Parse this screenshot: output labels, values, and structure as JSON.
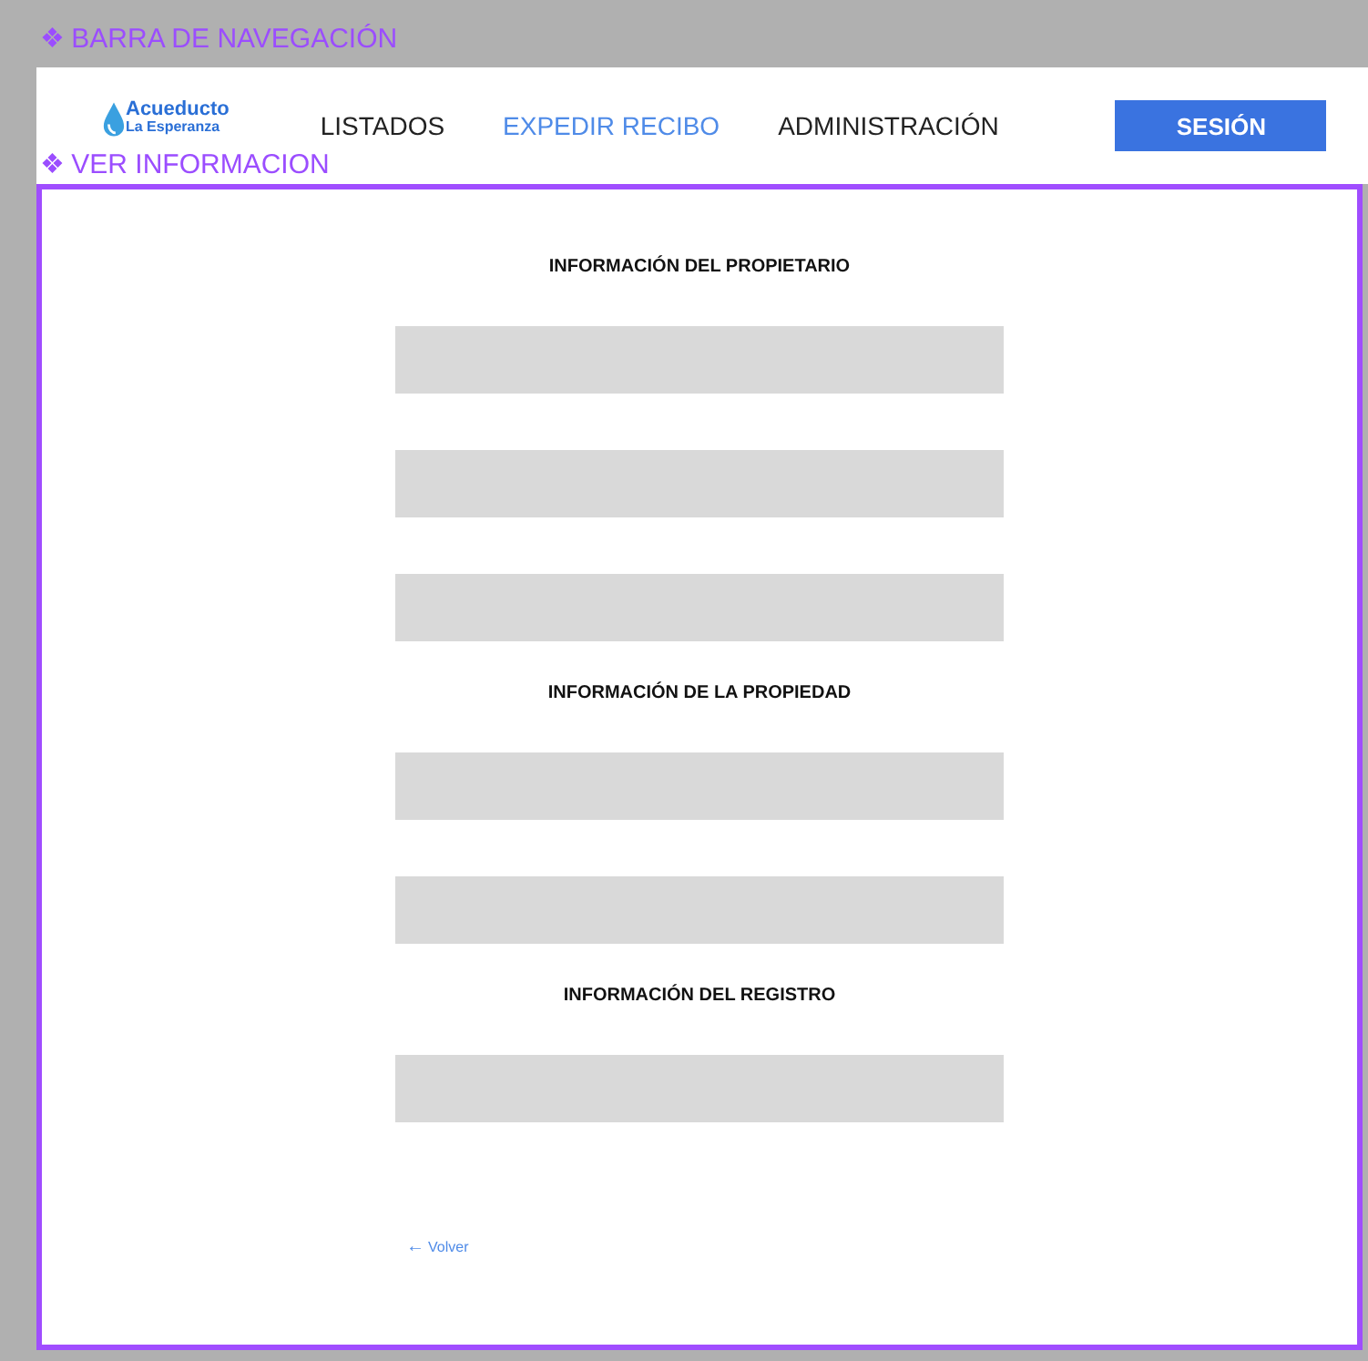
{
  "frame_labels": [
    "❖ BARRA DE NAVEGACIÓN",
    "❖ VER INFORMACION"
  ],
  "navbar": {
    "logo": {
      "title": "Acueducto",
      "subtitle": "La Esperanza"
    },
    "items": [
      {
        "label": "LISTADOS",
        "selected": false
      },
      {
        "label": "EXPEDIR RECIBO",
        "selected": true
      },
      {
        "label": "ADMINISTRACIÓN",
        "selected": false
      }
    ],
    "button": "SESIÓN"
  },
  "sections": [
    {
      "title": "INFORMACIÓN DEL PROPIETARIO",
      "fields": [
        {
          "kind": "input"
        },
        {
          "kind": "input"
        },
        {
          "kind": "input"
        }
      ]
    },
    {
      "title": "INFORMACIÓN DE LA PROPIEDAD",
      "fields": [
        {
          "kind": "input"
        },
        {
          "kind": "input"
        }
      ]
    },
    {
      "title": "INFORMACIÓN DEL REGISTRO",
      "fields": [
        {
          "kind": "input"
        }
      ]
    }
  ],
  "back_link": {
    "icon": "←",
    "label": "Volver"
  }
}
